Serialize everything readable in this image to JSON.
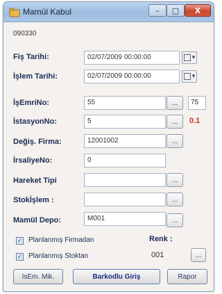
{
  "window": {
    "title": "Mamül Kabul",
    "minimize_glyph": "–",
    "maximize_glyph": "□",
    "close_glyph": "X"
  },
  "header": {
    "code": "090330"
  },
  "fields": {
    "fis_tarihi": {
      "label": "Fiş Tarihi:",
      "value": "02/07/2009 00:00:00"
    },
    "islem_tarihi": {
      "label": "İşlem Tarihi:",
      "value": "02/07/2009 00:00:00"
    },
    "is_emri_no": {
      "label": "İşEmriNo:",
      "value": "55",
      "side_value": "75"
    },
    "istasyon_no": {
      "label": "İstasyonNo:",
      "value": "5",
      "side_value": "0.1"
    },
    "degis_firma": {
      "label": "Değiş. Firma:",
      "value": "12001002"
    },
    "irsaliye_no": {
      "label": "İrsaliyeNo:",
      "value": "0"
    },
    "hareket_tipi": {
      "label": "Hareket Tipi",
      "value": ""
    },
    "stok_islem": {
      "label": "Stokİşlem :",
      "value": ""
    },
    "mamul_depo": {
      "label": "Mamül Depo:",
      "value": "M001"
    }
  },
  "dots_label": "...",
  "date_picker_glyph": "▾",
  "checkboxes": {
    "planlanmis_firmadan": {
      "label": "Planlanmış Firmadan",
      "checked": true
    },
    "planlanmis_stoktan": {
      "label": "Planlanmış Stoktan",
      "checked": true
    }
  },
  "renk": {
    "label": "Renk :",
    "value": "001"
  },
  "buttons": {
    "isem_mik": "IsEm. Mik.",
    "barkodlu_giris": "Barkodlu Giriş",
    "rapor": "Rapor"
  },
  "colors": {
    "accent_red": "#d0302a",
    "label_navy": "#1c2c55"
  }
}
